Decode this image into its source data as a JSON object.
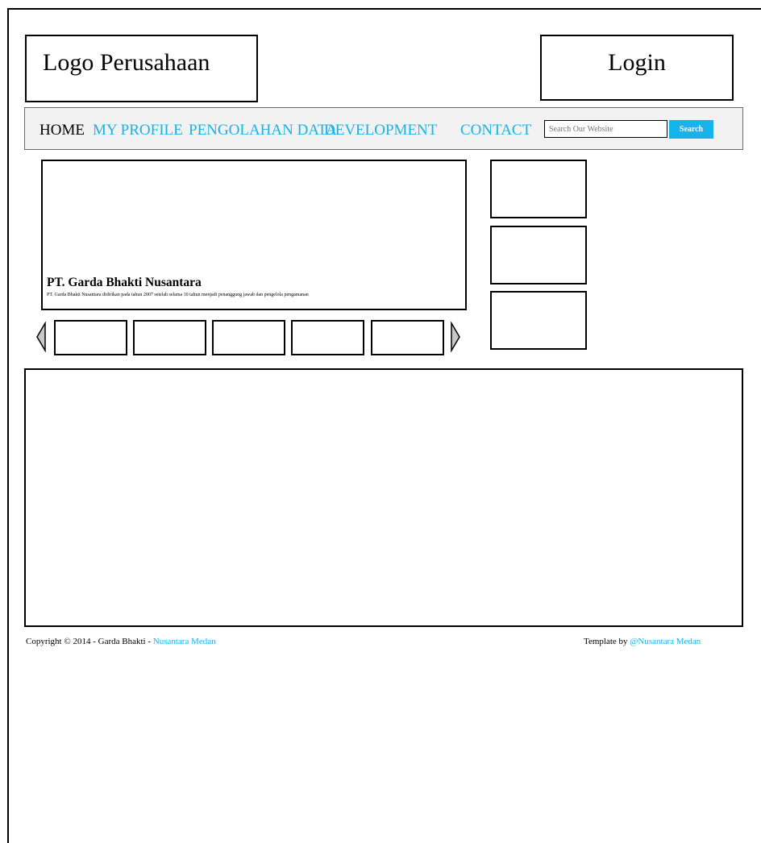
{
  "header": {
    "logo_text": "Logo Perusahaan",
    "login_text": "Login"
  },
  "nav": {
    "items": [
      "HOME",
      "MY PROFILE",
      "PENGOLAHAN DATA",
      "DEVELOPMENT",
      "CONTACT"
    ],
    "search_placeholder": "Search Our Website",
    "search_button": "Search"
  },
  "slider": {
    "title": "PT. Garda Bhakti Nusantara",
    "description": "PT. Garda Bhakti Nusantara didirikan pada tahun 2007 setelah selama 10 tahun menjadi penanggung jawab dan pengelola pengamanan"
  },
  "footer": {
    "copyright_prefix": "Copyright © 2014 - Garda Bhakti - ",
    "copyright_link": "Nusantara Medan",
    "template_prefix": "Template by ",
    "template_link": "@Nusantara Medan"
  },
  "colors": {
    "accent": "#1ab2e6",
    "button": "#19b3ec",
    "nav_bg": "#f2f2f2"
  }
}
